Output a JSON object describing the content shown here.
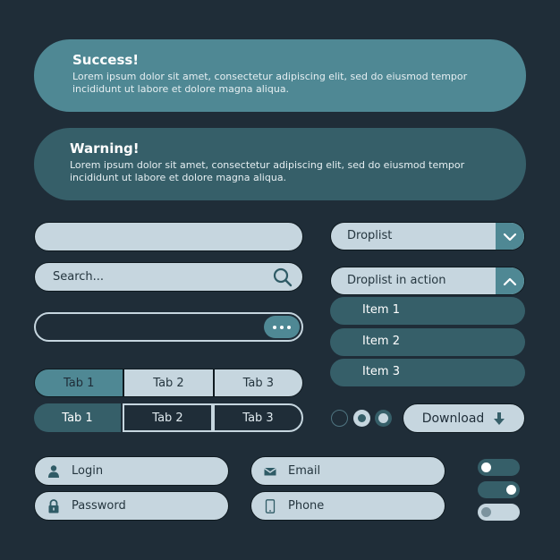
{
  "colors": {
    "background": "#1f2d38",
    "success": "#4f8894",
    "warning": "#365f69",
    "light": "#c6d6df",
    "text_dark": "#25363f"
  },
  "alerts": {
    "success": {
      "title": "Success!",
      "body": "Lorem ipsum dolor sit amet, consectetur adipiscing elit, sed do eiusmod tempor incididunt ut labore et dolore magna aliqua."
    },
    "warning": {
      "title": "Warning!",
      "body": "Lorem ipsum dolor sit amet, consectetur adipiscing elit, sed do eiusmod tempor incididunt ut labore et dolore magna aliqua."
    }
  },
  "inputs": {
    "blank": {
      "value": ""
    },
    "search": {
      "placeholder": "Search...",
      "icon": "search-icon"
    },
    "dark": {
      "value": "",
      "button_icon": "more-dots-icon"
    }
  },
  "tabs": {
    "light_row": [
      {
        "label": "Tab 1",
        "active": true
      },
      {
        "label": "Tab 2",
        "active": false
      },
      {
        "label": "Tab 3",
        "active": false
      }
    ],
    "dark_row": [
      {
        "label": "Tab 1",
        "active": true
      },
      {
        "label": "Tab 2",
        "active": false
      },
      {
        "label": "Tab 3",
        "active": false
      }
    ]
  },
  "droplists": {
    "closed": {
      "label": "Droplist",
      "icon": "chevron-down-icon"
    },
    "open": {
      "label": "Droplist in action",
      "icon": "chevron-up-icon",
      "items": [
        "Item 1",
        "Item 2",
        "Item 3"
      ]
    }
  },
  "radios": [
    {
      "state": "unchecked"
    },
    {
      "state": "checked"
    },
    {
      "state": "checked-inverse"
    }
  ],
  "download": {
    "label": "Download",
    "icon": "download-arrow-icon"
  },
  "form": {
    "login": {
      "placeholder": "Login",
      "icon": "user-icon"
    },
    "password": {
      "placeholder": "Password",
      "icon": "lock-icon"
    },
    "email": {
      "placeholder": "Email",
      "icon": "envelope-icon"
    },
    "phone": {
      "placeholder": "Phone",
      "icon": "phone-icon"
    }
  },
  "toggles": [
    {
      "on": false,
      "style": "dark"
    },
    {
      "on": true,
      "style": "dark"
    },
    {
      "on": false,
      "style": "light"
    }
  ]
}
